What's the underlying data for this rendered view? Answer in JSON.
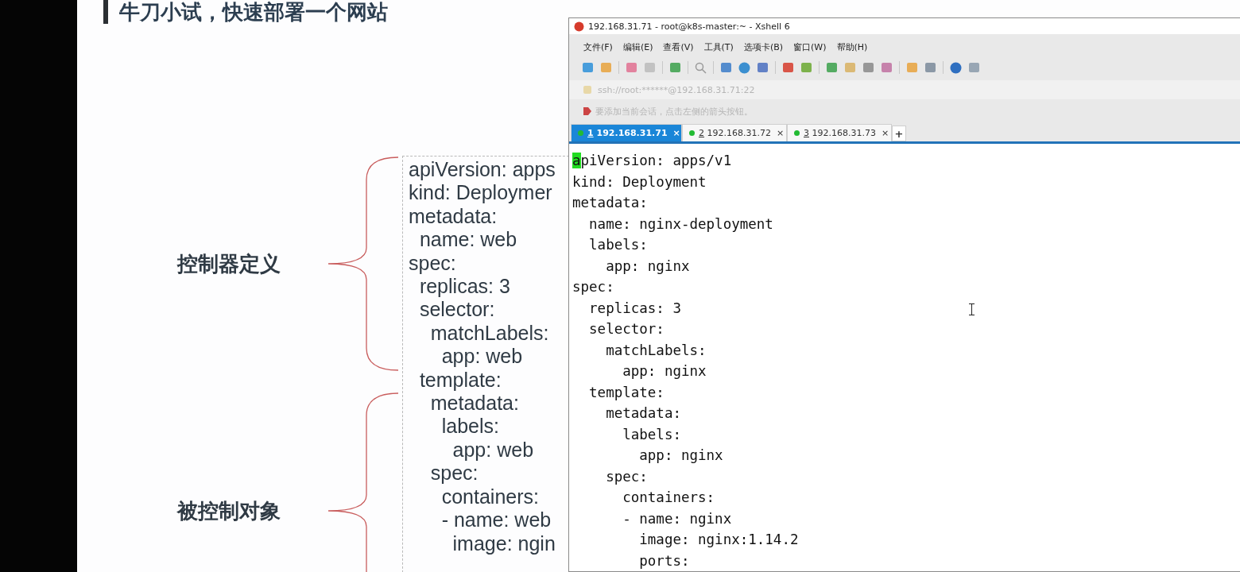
{
  "slide": {
    "title": "牛刀小试，快速部署一个网站",
    "groups": [
      {
        "label": "控制器定义"
      },
      {
        "label": "被控制对象"
      }
    ],
    "code_lines": [
      "apiVersion: apps",
      "kind: Deploymer",
      "metadata:",
      "  name: web",
      "spec:",
      "  replicas: 3",
      "  selector:",
      "    matchLabels:",
      "      app: web",
      "  template:",
      "    metadata:",
      "      labels:",
      "        app: web",
      "    spec:",
      "      containers:",
      "      - name: web",
      "        image: ngin"
    ]
  },
  "xshell": {
    "window": {
      "title": "192.168.31.71 - root@k8s-master:~ - Xshell 6"
    },
    "menu": [
      "文件(F)",
      "编辑(E)",
      "查看(V)",
      "工具(T)",
      "选项卡(B)",
      "窗口(W)",
      "帮助(H)"
    ],
    "address": "ssh://root:******@192.168.31.71:22",
    "hint": "要添加当前会话，点击左侧的箭头按钮。",
    "tabs": [
      {
        "key": "1",
        "label": " 192.168.31.71",
        "close": "×",
        "selected": true
      },
      {
        "key": "2",
        "label": " 192.168.31.72",
        "close": "×",
        "selected": false
      },
      {
        "key": "3",
        "label": " 192.168.31.73",
        "close": "×",
        "selected": false
      }
    ],
    "new_tab": "+",
    "terminal": {
      "cursor_char": "a",
      "lines": [
        "piVersion: apps/v1",
        "kind: Deployment",
        "metadata:",
        "  name: nginx-deployment",
        "  labels:",
        "    app: nginx",
        "spec:",
        "  replicas: 3",
        "  selector:",
        "    matchLabels:",
        "      app: nginx",
        "  template:",
        "    metadata:",
        "      labels:",
        "        app: nginx",
        "    spec:",
        "      containers:",
        "      - name: nginx",
        "        image: nginx:1.14.2",
        "        ports:"
      ]
    }
  }
}
